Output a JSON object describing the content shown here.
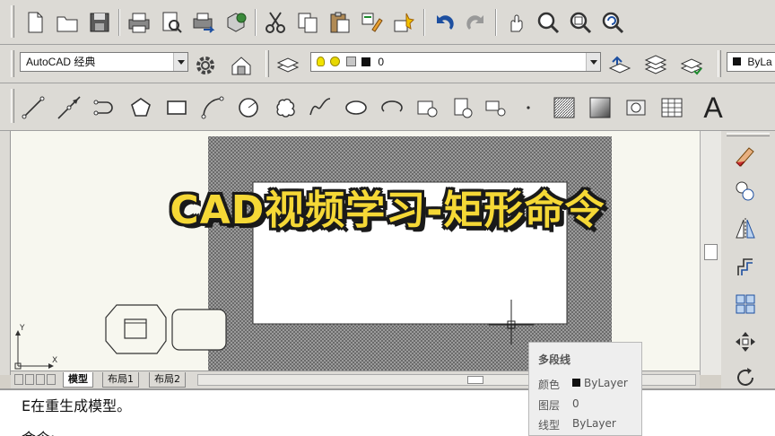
{
  "toolbar_standard": {
    "icons": [
      "new-file-icon",
      "open-folder-icon",
      "save-icon",
      "print-icon",
      "print-preview-icon",
      "publish-icon",
      "publish-3d-icon",
      "cut-icon",
      "copy-icon",
      "paste-icon",
      "match-properties-icon",
      "block-editor-icon",
      "undo-icon",
      "redo-icon",
      "pan-icon",
      "zoom-realtime-icon",
      "zoom-window-icon",
      "zoom-previous-icon"
    ]
  },
  "workspace": {
    "value": "AutoCAD 经典"
  },
  "layer": {
    "value": "0"
  },
  "linetype": {
    "value": "ByLa"
  },
  "draw_tools": {
    "text_tool_label": "A"
  },
  "title_overlay": {
    "text": "CAD视频学习-矩形命令"
  },
  "tabs": [
    {
      "label": "模型",
      "active": true
    },
    {
      "label": "布局1",
      "active": false
    },
    {
      "label": "布局2",
      "active": false
    }
  ],
  "ucs": {
    "y_label": "Y",
    "x_label": "X"
  },
  "command": {
    "line1": "E在重生成模型。",
    "line2": "命令:"
  },
  "properties_tooltip": {
    "title": "多段线",
    "rows": [
      {
        "label": "颜色",
        "value": "ByLayer"
      },
      {
        "label": "图层",
        "value": "0"
      },
      {
        "label": "线型",
        "value": "ByLayer"
      }
    ]
  },
  "colors": {
    "title_fill": "#f5d836",
    "title_outline": "#1a1a1a",
    "canvas_bg": "#f7f7ef",
    "hatch": "#7a7a7a"
  }
}
